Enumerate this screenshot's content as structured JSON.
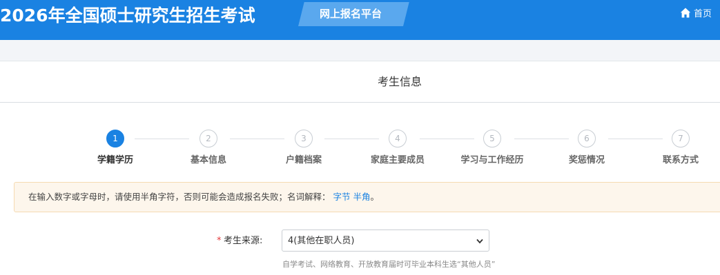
{
  "header": {
    "title": "2026年全国硕士研究生招生考试",
    "badge": "网上报名平台",
    "home_label": "首页",
    "home_icon": "home-icon"
  },
  "section": {
    "title": "考生信息"
  },
  "steps": [
    {
      "num": "1",
      "label": "学籍学历",
      "active": true
    },
    {
      "num": "2",
      "label": "基本信息",
      "active": false
    },
    {
      "num": "3",
      "label": "户籍档案",
      "active": false
    },
    {
      "num": "4",
      "label": "家庭主要成员",
      "active": false
    },
    {
      "num": "5",
      "label": "学习与工作经历",
      "active": false
    },
    {
      "num": "6",
      "label": "奖惩情况",
      "active": false
    },
    {
      "num": "7",
      "label": "联系方式",
      "active": false
    }
  ],
  "notice": {
    "text": "在输入数字或字母时，请使用半角字符，否则可能会造成报名失败；名词解释：",
    "link1": "字节",
    "link2": "半角",
    "end": "。"
  },
  "form": {
    "required_mark": "*",
    "source_label": "考生来源:",
    "source_value": "4(其他在职人员)",
    "source_hint": "自学考试、网络教育、开放教育届时可毕业本科生选“其他人员”"
  },
  "colors": {
    "primary": "#1a82e2",
    "notice_bg": "#fdf6ec",
    "required": "#e4393c"
  }
}
